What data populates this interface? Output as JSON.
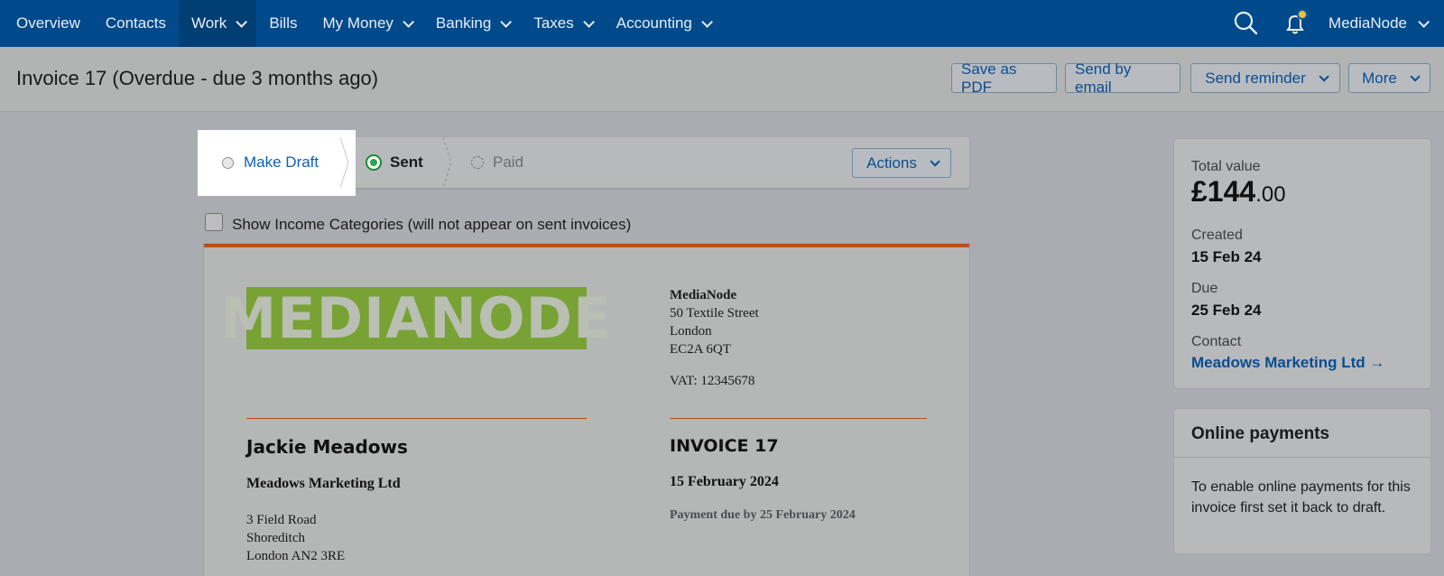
{
  "nav": {
    "items": [
      {
        "label": "Overview",
        "has_menu": false,
        "active": false
      },
      {
        "label": "Contacts",
        "has_menu": false,
        "active": false
      },
      {
        "label": "Work",
        "has_menu": true,
        "active": true
      },
      {
        "label": "Bills",
        "has_menu": false,
        "active": false
      },
      {
        "label": "My Money",
        "has_menu": true,
        "active": false
      },
      {
        "label": "Banking",
        "has_menu": true,
        "active": false
      },
      {
        "label": "Taxes",
        "has_menu": true,
        "active": false
      },
      {
        "label": "Accounting",
        "has_menu": true,
        "active": false
      }
    ],
    "search_icon": "search-icon",
    "notification_icon": "bell-icon",
    "user_label": "MediaNode"
  },
  "header": {
    "title": "Invoice 17 (Overdue - due 3 months ago)",
    "save_pdf": "Save as PDF",
    "send_email": "Send by email",
    "send_reminder": "Send reminder",
    "more": "More"
  },
  "status": {
    "make_draft": "Make Draft",
    "sent": "Sent",
    "paid": "Paid",
    "actions": "Actions"
  },
  "options": {
    "show_categories": "Show Income Categories (will not appear on sent invoices)"
  },
  "invoice": {
    "logo_text": "MEDIANODE",
    "company_name": "MediaNode",
    "company_address": [
      "50 Textile Street",
      "London",
      "EC2A 6QT"
    ],
    "vat": "VAT: 12345678",
    "customer_name": "Jackie Meadows",
    "customer_company": "Meadows Marketing Ltd",
    "customer_address": [
      "3 Field Road",
      "Shoreditch",
      "London AN2 3RE"
    ],
    "title": "INVOICE 17",
    "date": "15 February 2024",
    "due_text": "Payment due by 25 February 2024"
  },
  "summary": {
    "total_label": "Total value",
    "total_pounds": "£144",
    "total_pence": ".00",
    "created_label": "Created",
    "created_value": "15 Feb 24",
    "due_label": "Due",
    "due_value": "25 Feb 24",
    "contact_label": "Contact",
    "contact_value": "Meadows Marketing Ltd →"
  },
  "payments": {
    "title": "Online payments",
    "text": "To enable online payments for this invoice first set it back to draft."
  },
  "colors": {
    "nav_bg": "#004a8b",
    "link": "#0b4d8f",
    "accent_line": "#b5501f",
    "logo_green": "#78a233",
    "sent_green": "#2da44e"
  }
}
